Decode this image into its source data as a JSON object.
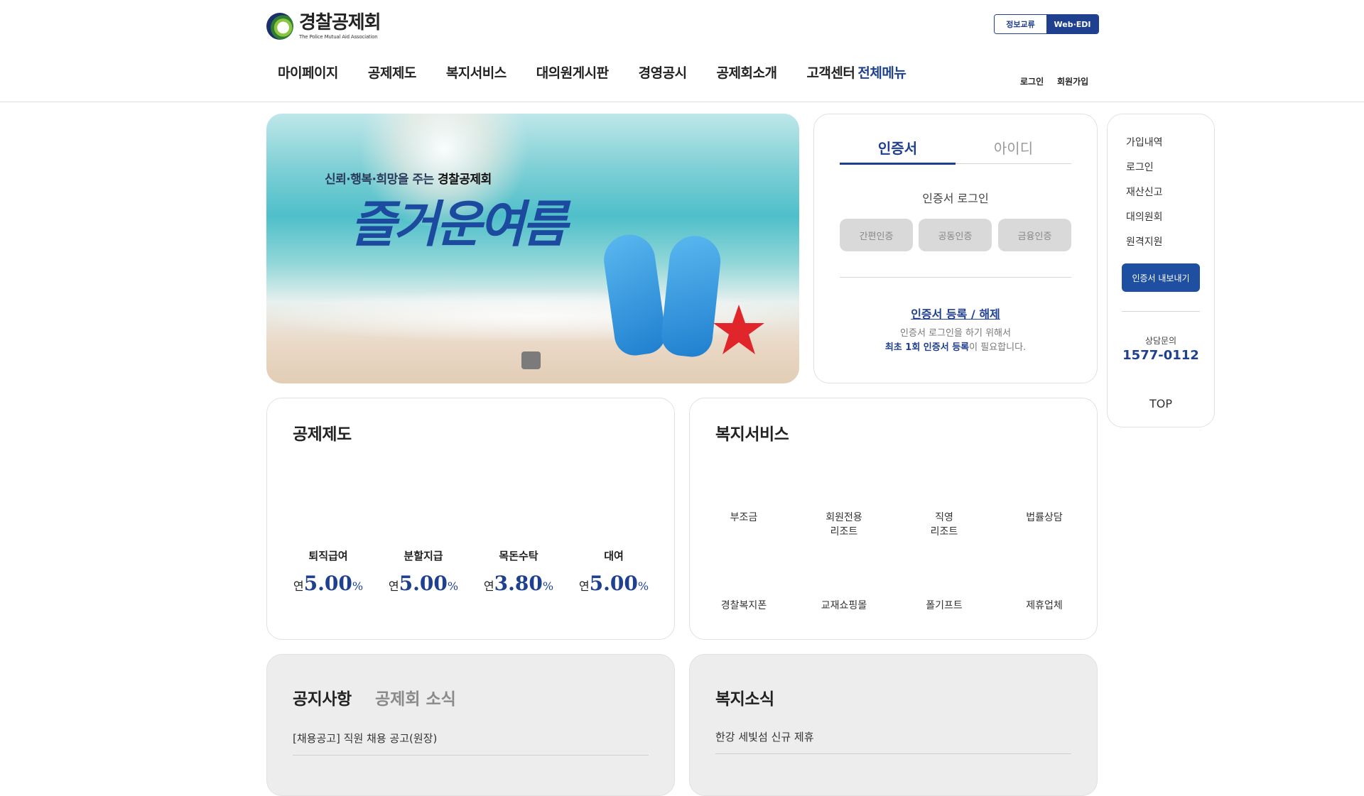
{
  "header": {
    "logo_ko": "경찰공제회",
    "logo_en": "The Police Mutual Aid Association",
    "top_buttons": [
      "정보교류",
      "Web·EDI"
    ],
    "nav": [
      "마이페이지",
      "공제제도",
      "복지서비스",
      "대의원게시판",
      "경영공시",
      "공제회소개",
      "고객센터"
    ],
    "all_menu": "전체메뉴",
    "login": "로그인",
    "signup": "회원가입"
  },
  "banner": {
    "subtitle_prefix": "신뢰·행복·희망을 주는 ",
    "subtitle_bold": "경찰공제회",
    "title": "즐거운여름"
  },
  "login_panel": {
    "tabs": [
      "인증서",
      "아이디"
    ],
    "title": "인증서 로그인",
    "buttons": [
      "간편인증",
      "공동인증",
      "금융인증"
    ],
    "register_link": "인증서 등록 / 해제",
    "desc_line1": "인증서 로그인을 하기 위해서",
    "desc_bold": "최초 1회 인증서 등록",
    "desc_tail": "이 필요합니다."
  },
  "quick_menu": {
    "items": [
      "가입내역",
      "로그인",
      "재산신고",
      "대의원회",
      "원격지원"
    ],
    "export_button": "인증서 내보내기",
    "contact_label": "상담문의",
    "phone": "1577-0112",
    "top": "TOP"
  },
  "benefits": {
    "title": "공제제도",
    "rates": [
      {
        "label": "퇴직급여",
        "prefix": "연",
        "value": "5.00",
        "unit": "%"
      },
      {
        "label": "분할지급",
        "prefix": "연",
        "value": "5.00",
        "unit": "%"
      },
      {
        "label": "목돈수탁",
        "prefix": "연",
        "value": "3.80",
        "unit": "%"
      },
      {
        "label": "대여",
        "prefix": "연",
        "value": "5.00",
        "unit": "%"
      }
    ]
  },
  "welfare": {
    "title": "복지서비스",
    "row1": [
      "부조금",
      "회원전용\n리조트",
      "직영\n리조트",
      "법률상담"
    ],
    "row2": [
      "경찰복지폰",
      "교재쇼핑몰",
      "폴기프트",
      "제휴업체"
    ]
  },
  "notice": {
    "tab_active": "공지사항",
    "tab_inactive": "공제회 소식",
    "items": [
      "[채용공고] 직원 채용 공고(원장)"
    ]
  },
  "welfare_news": {
    "title": "복지소식",
    "items": [
      "한강 세빛섬 신규 제휴"
    ]
  }
}
